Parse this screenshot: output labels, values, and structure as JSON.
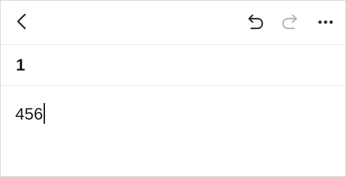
{
  "toolbar": {
    "icons": {
      "back": "chevron-left-icon",
      "undo": "undo-icon",
      "redo": "redo-icon",
      "more": "more-horizontal-icon"
    },
    "redo_enabled": false,
    "colors": {
      "icon_active": "#2b2b2b",
      "icon_disabled": "#b5b5b5"
    }
  },
  "note": {
    "title": "1",
    "body": "456"
  }
}
